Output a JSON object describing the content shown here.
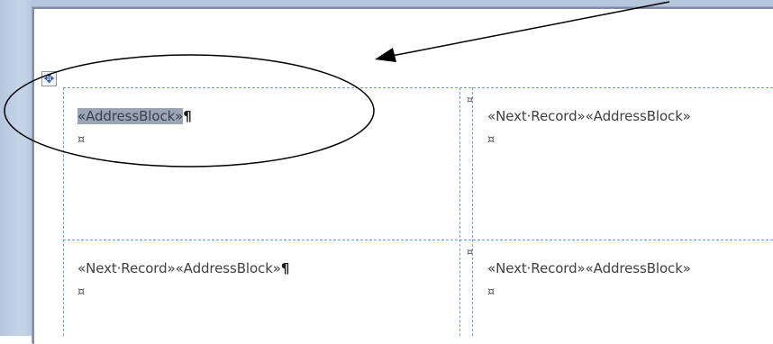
{
  "document": {
    "move_handle_icon": "table-move-handle-icon",
    "cells": [
      {
        "field": "«AddressBlock»",
        "pilcrow": "¶",
        "end_mark": "¤",
        "highlighted": true
      },
      {
        "field": "«Next·Record»«AddressBlock»",
        "pilcrow": "",
        "end_mark": "¤",
        "highlighted": false
      },
      {
        "field": "«Next·Record»«AddressBlock»",
        "pilcrow": "¶",
        "end_mark": "¤",
        "highlighted": false
      },
      {
        "field": "«Next·Record»«AddressBlock»",
        "pilcrow": "",
        "end_mark": "¤",
        "highlighted": false
      }
    ],
    "row_end_marks": [
      "¤",
      "¤"
    ]
  },
  "annotation": {
    "circle_color": "#000000",
    "arrow_color": "#000000"
  },
  "colors": {
    "gridline": "#6fa0d6",
    "selection": "#9ba5b5"
  }
}
